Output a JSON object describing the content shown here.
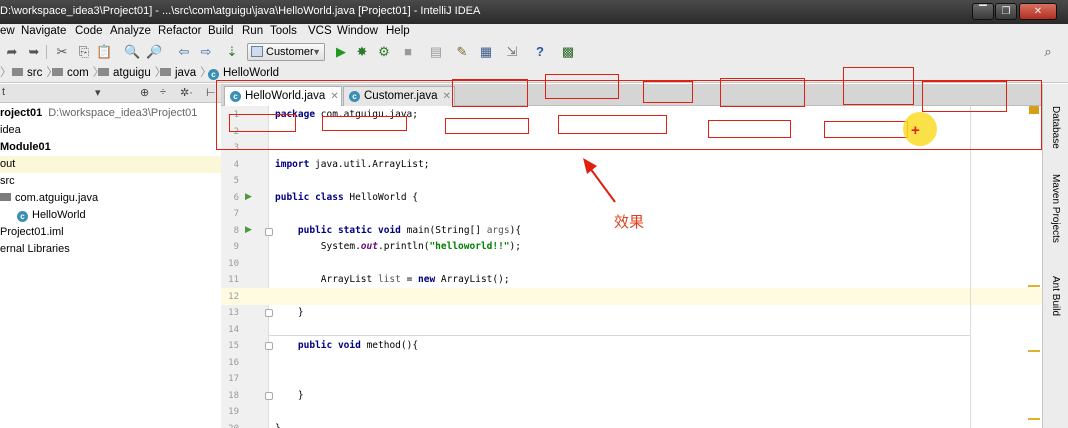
{
  "window": {
    "title": "D:\\workspace_idea3\\Project01] - ...\\src\\com\\atguigu\\java\\HelloWorld.java [Project01] - IntelliJ IDEA",
    "buttons": [
      "▔",
      "❐",
      "✕"
    ]
  },
  "menu": [
    "ew",
    "Navigate",
    "Code",
    "Analyze",
    "Refactor",
    "Build",
    "Run",
    "Tools",
    "VCS",
    "Window",
    "Help"
  ],
  "toolbar": {
    "run_config": "Customer"
  },
  "breadcrumb": [
    "src",
    "com",
    "atguigu",
    "java",
    "HelloWorld"
  ],
  "project_panel": {
    "header_left": "t",
    "header_caret": "▾",
    "header_icons": [
      "⊕",
      "÷",
      "✲·",
      "⊢"
    ],
    "tree": [
      {
        "label": "roject01",
        "sub": "D:\\workspace_idea3\\Project01",
        "bold": true
      },
      {
        "label": "idea"
      },
      {
        "label": "Module01",
        "bold": true
      },
      {
        "label": "out",
        "highlight": true
      },
      {
        "label": "src"
      },
      {
        "label": "com.atguigu.java"
      },
      {
        "label": "HelloWorld"
      },
      {
        "label": "Project01.iml"
      },
      {
        "label": "ernal Libraries"
      }
    ]
  },
  "tabs": [
    {
      "label": "HelloWorld.java",
      "active": true
    },
    {
      "label": "Customer.java",
      "active": false
    }
  ],
  "code_lines": [
    {
      "n": "1",
      "text": "package com.atguigu.java;"
    },
    {
      "n": "2",
      "text": ""
    },
    {
      "n": "3",
      "text": ""
    },
    {
      "n": "4",
      "text": "import java.util.ArrayList;"
    },
    {
      "n": "5",
      "text": ""
    },
    {
      "n": "6",
      "text": "public class HelloWorld {"
    },
    {
      "n": "7",
      "text": ""
    },
    {
      "n": "8",
      "text": "    public static void main(String[] args){"
    },
    {
      "n": "9",
      "text": "        System.out.println(\"helloworld!!\");"
    },
    {
      "n": "10",
      "text": ""
    },
    {
      "n": "11",
      "text": "        ArrayList list = new ArrayList();"
    },
    {
      "n": "12",
      "text": ""
    },
    {
      "n": "13",
      "text": "    }"
    },
    {
      "n": "14",
      "text": ""
    },
    {
      "n": "15",
      "text": "    public void method(){"
    },
    {
      "n": "16",
      "text": ""
    },
    {
      "n": "17",
      "text": ""
    },
    {
      "n": "18",
      "text": "    }"
    },
    {
      "n": "19",
      "text": ""
    },
    {
      "n": "20",
      "text": "}"
    }
  ],
  "right_strip": [
    "Database",
    "Maven Projects",
    "Ant Build"
  ],
  "annotation": {
    "note": "效果",
    "color": "#e02010"
  }
}
